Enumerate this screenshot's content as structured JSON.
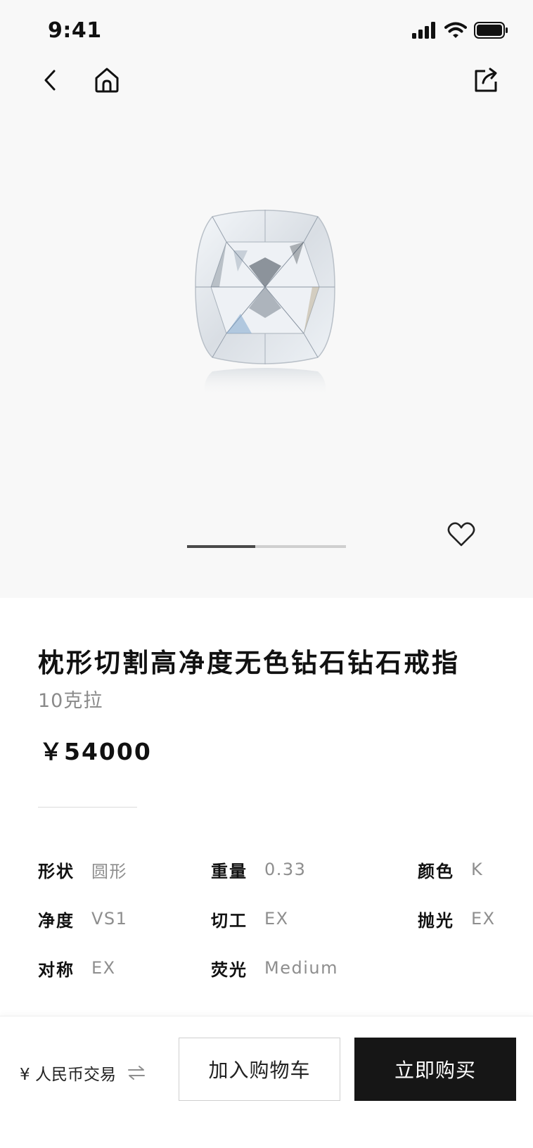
{
  "status_bar": {
    "time": "9:41",
    "icons": [
      "signal-icon",
      "wifi-icon",
      "battery-icon"
    ]
  },
  "nav": {
    "icons": [
      "back-icon",
      "home-icon",
      "share-icon"
    ]
  },
  "gallery": {
    "image": "diamond-cushion-cut",
    "slide_progress": 0.43,
    "favorite_icon": "heart-icon"
  },
  "product": {
    "title": "枕形切割高净度无色钻石钻石戒指",
    "subtitle": "10克拉",
    "price": "￥54000"
  },
  "specs": [
    {
      "label": "形状",
      "value": "圆形"
    },
    {
      "label": "重量",
      "value": "0.33"
    },
    {
      "label": "颜色",
      "value": "K"
    },
    {
      "label": "净度",
      "value": "VS1"
    },
    {
      "label": "切工",
      "value": "EX"
    },
    {
      "label": "抛光",
      "value": "EX"
    },
    {
      "label": "对称",
      "value": "EX"
    },
    {
      "label": "荧光",
      "value": "Medium"
    }
  ],
  "actions": {
    "currency_label": "¥ 人民币交易",
    "swap_icon": "swap-icon",
    "add_to_cart": "加入购物车",
    "buy_now": "立即购买"
  },
  "colors": {
    "hero_bg": "#f8f8f8",
    "primary_dark": "#161616",
    "muted_text": "#8e8e8e"
  }
}
